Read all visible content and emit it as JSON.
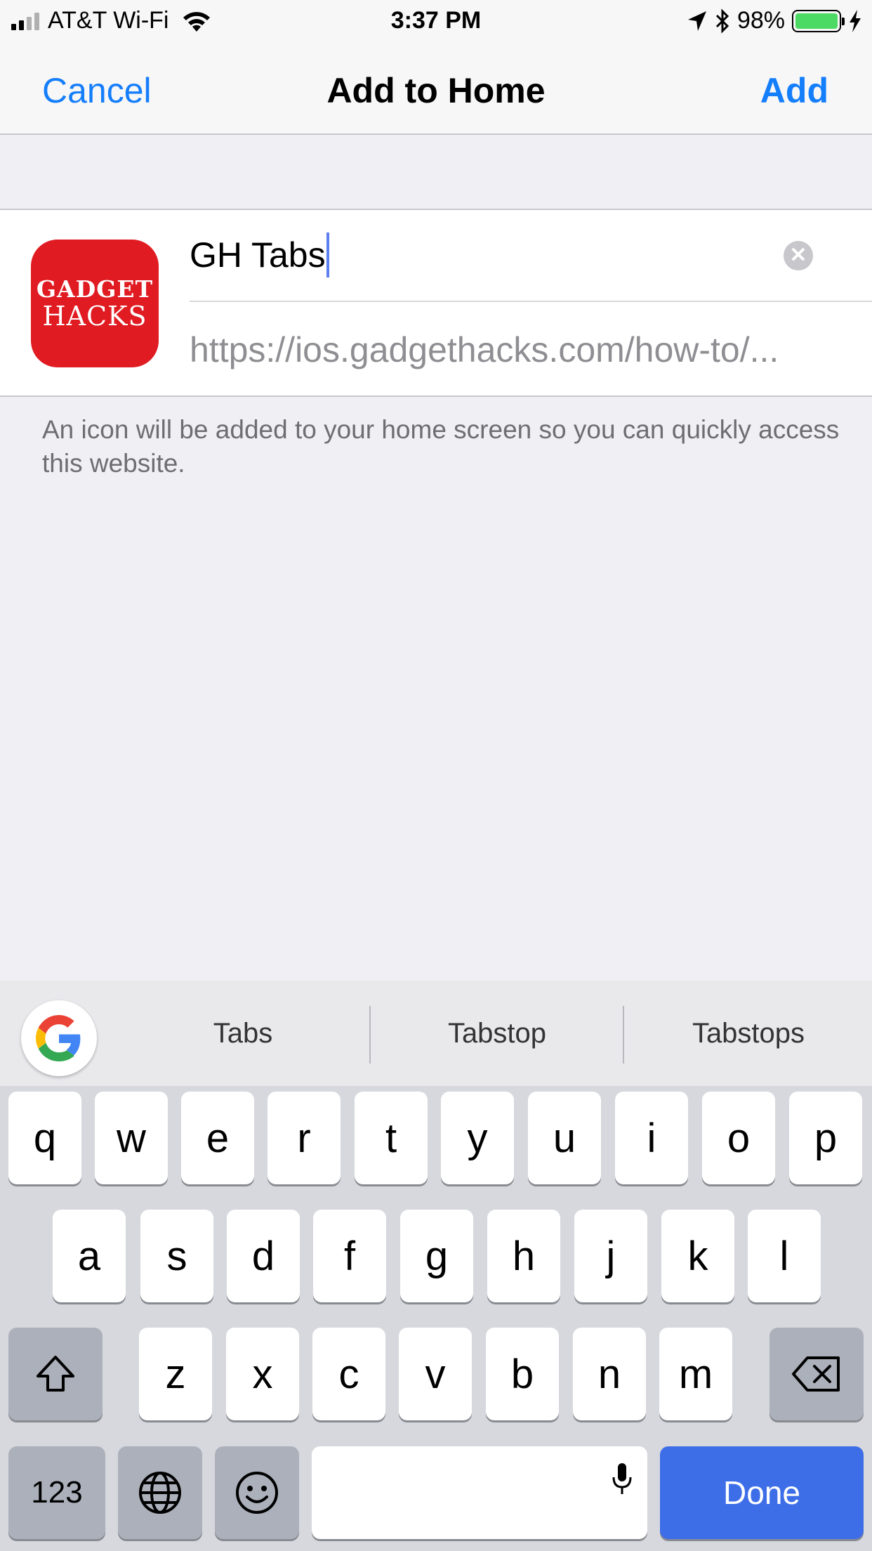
{
  "status_bar": {
    "carrier": "AT&T Wi-Fi",
    "time": "3:37 PM",
    "battery_percent": "98%",
    "battery_color": "#4cd964",
    "icons": [
      "signal-icon",
      "wifi-icon",
      "location-icon",
      "bluetooth-icon",
      "battery-icon",
      "charging-icon"
    ]
  },
  "nav": {
    "cancel_label": "Cancel",
    "title": "Add to Home",
    "add_label": "Add",
    "accent_color": "#157efb"
  },
  "form": {
    "icon_line1": "GADGET",
    "icon_line2": "HACKS",
    "icon_color": "#e01b22",
    "name_value": "GH Tabs",
    "url_value": "https://ios.gadgethacks.com/how-to/..."
  },
  "hint_text": "An icon will be added to your home screen so you can quickly access this website.",
  "keyboard": {
    "suggestions": [
      "Tabs",
      "Tabstop",
      "Tabstops"
    ],
    "row1": [
      "q",
      "w",
      "e",
      "r",
      "t",
      "y",
      "u",
      "i",
      "o",
      "p"
    ],
    "row2": [
      "a",
      "s",
      "d",
      "f",
      "g",
      "h",
      "j",
      "k",
      "l"
    ],
    "row3": [
      "z",
      "x",
      "c",
      "v",
      "b",
      "n",
      "m"
    ],
    "numbers_label": "123",
    "done_label": "Done",
    "done_color": "#3d6ee8"
  }
}
